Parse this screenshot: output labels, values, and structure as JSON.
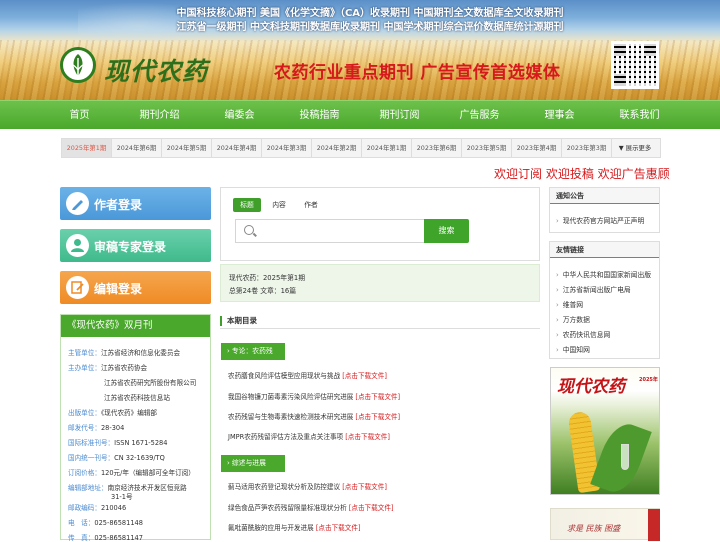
{
  "banner": {
    "line1": "中国科技核心期刊 美国《化学文摘》（CA）收录期刊   中国期刊全文数据库全文收录期刊",
    "line2": "江苏省一级期刊   中文科技期刊数据库收录期刊   中国学术期刊综合评价数据库统计源期刊",
    "logo_text": "现代农药",
    "slogan": "农药行业重点期刊    广告宣传首选媒体"
  },
  "nav": {
    "items": [
      {
        "label": "首页"
      },
      {
        "label": "期刊介绍"
      },
      {
        "label": "编委会"
      },
      {
        "label": "投稿指南"
      },
      {
        "label": "期刊订阅"
      },
      {
        "label": "广告服务"
      },
      {
        "label": "理事会"
      },
      {
        "label": "联系我们"
      }
    ]
  },
  "issues": {
    "items": [
      "2025年第1期",
      "2024年第6期",
      "2024年第5期",
      "2024年第4期",
      "2024年第3期",
      "2024年第2期",
      "2024年第1期",
      "2023年第6期",
      "2023年第5期",
      "2023年第4期",
      "2023年第3期"
    ],
    "more": "▼ 展示更多"
  },
  "welcome": "欢迎订阅 欢迎投稿 欢迎广告惠顾",
  "left_buttons": {
    "author": "作者登录",
    "reviewer": "审稿专家登录",
    "editor": "编辑登录"
  },
  "journal_info": {
    "title": "《现代农药》双月刊",
    "competent_label": "主管单位：",
    "competent": "江苏省经济和信息化委员会",
    "sponsor_label": "主办单位：",
    "sponsor1": "江苏省农药协会",
    "sponsor2": "江苏省农药研究所股份有限公司",
    "sponsor3": "江苏省农药科技信息站",
    "publisher_label": "出版单位：",
    "publisher": "《现代农药》编辑部",
    "post_code_label": "邮发代号：",
    "post_code": "28-304",
    "issn_label": "国际标准刊号：",
    "issn": "ISSN 1671-5284",
    "cn_label": "国内统一刊号：",
    "cn": "CN 32-1639/TQ",
    "price_label": "订阅价格：",
    "price": "120元/年（编辑部可全年订阅）",
    "address_label": "编辑部地址：",
    "address1": "南京经济技术开发区恒竞路",
    "address2": "31-1号",
    "zip_label": "邮政编码：",
    "zip": "210046",
    "tel_label": "电　话：",
    "tel": "025-86581148",
    "fax_label": "传　真：",
    "fax": "025-86581147"
  },
  "search": {
    "tabs": [
      "标题",
      "内容",
      "作者"
    ],
    "active_tab": "标题",
    "placeholder": "",
    "button": "搜索"
  },
  "current_issue": {
    "line1": "现代农药：2025年第1期",
    "line2": "总第24卷  文章：16篇"
  },
  "toc": {
    "title": "本期目录",
    "sections": [
      {
        "name": "专论：农药残",
        "articles": [
          {
            "title": "农药膳食风险评估模型应用现状与挑战",
            "link": "[点击下载文件]"
          },
          {
            "title": "我国谷物镰刀菌毒素污染风险评估研究进展",
            "link": "[点击下载文件]"
          },
          {
            "title": "农药残留与生物毒素快速检测技术研究进展",
            "link": "[点击下载文件]"
          },
          {
            "title": "JMPR农药残留评估方法及重点关注事项",
            "link": "[点击下载文件]"
          }
        ]
      },
      {
        "name": "综述与进展",
        "articles": [
          {
            "title": "蓟马适用农药登记现状分析及防控建议",
            "link": "[点击下载文件]"
          },
          {
            "title": "绿色食品芦笋农药残留限量标准现状分析",
            "link": "[点击下载文件]"
          },
          {
            "title": "氟吡菌酰胺的应用与开发进展",
            "link": "[点击下载文件]"
          }
        ]
      }
    ]
  },
  "notice": {
    "title": "通知公告",
    "items": [
      "现代农药官方网站严正声明"
    ]
  },
  "links": {
    "title": "友情链接",
    "items": [
      "中华人民共和国国家新闻出版",
      "江苏省新闻出版广电局",
      "维普网",
      "万方数据",
      "农药快讯信息网",
      "中国知网"
    ]
  },
  "cover": {
    "title": "现代农药",
    "year": "2025年",
    "second_text": "求是 民族 图盛"
  },
  "colors": {
    "nav_green": "#4aa82c",
    "accent_red": "#d6191b",
    "author_blue": "#4a98d8",
    "reviewer_teal": "#3fba8c",
    "editor_orange": "#ef8b25"
  }
}
